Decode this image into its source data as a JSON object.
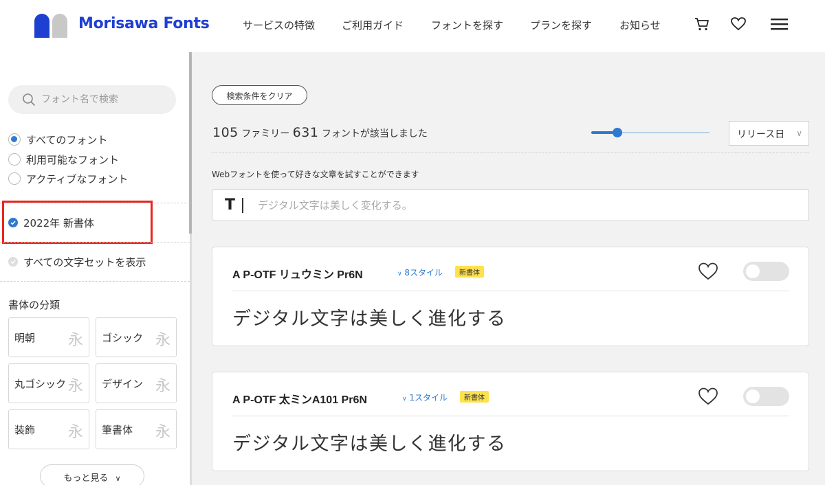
{
  "header": {
    "brand": "Morisawa Fonts",
    "nav": [
      "サービスの特徴",
      "ご利用ガイド",
      "フォントを探す",
      "プランを探す",
      "お知らせ"
    ],
    "icons": [
      "cart-icon",
      "heart-icon",
      "hamburger-menu-icon"
    ],
    "brand_color": "#1f3fd1"
  },
  "sidebar": {
    "search_placeholder": "フォント名で検索",
    "font_scope": [
      {
        "label": "すべてのフォント",
        "selected": true
      },
      {
        "label": "利用可能なフォント",
        "selected": false
      },
      {
        "label": "アクティブなフォント",
        "selected": false
      }
    ],
    "new_fonts_filter": {
      "label": "2022年 新書体",
      "checked": true
    },
    "charset_filter": {
      "label": "すべての文字セットを表示",
      "checked": false
    },
    "classification_title": "書体の分類",
    "categories": [
      {
        "label": "明朝",
        "glyph": "永"
      },
      {
        "label": "ゴシック",
        "glyph": "永"
      },
      {
        "label": "丸ゴシック",
        "glyph": "永"
      },
      {
        "label": "デザイン",
        "glyph": "永"
      },
      {
        "label": "装飾",
        "glyph": "永"
      },
      {
        "label": "筆書体",
        "glyph": "永"
      }
    ],
    "more_label": "もっと見る"
  },
  "main": {
    "clear_label": "検索条件をクリア",
    "result": {
      "families": "105",
      "families_unit": "ファミリー",
      "fonts": "631",
      "fonts_suffix": "フォントが該当しました"
    },
    "size_slider_fraction": 0.22,
    "sort_label": "リリース日",
    "hint": "Webフォントを使って好きな文章を試すことができます",
    "try_icon_letter": "T",
    "try_placeholder": "デジタル文字は美しく変化する。",
    "accent_color": "#2e7ad1",
    "badge_color": "#ffe14d"
  },
  "cards": [
    {
      "name": "A P-OTF リュウミン Pr6N",
      "styles": "8スタイル",
      "badge": "新書体",
      "sample": "デジタル文字は美しく進化する",
      "active": false
    },
    {
      "name": "A P-OTF 太ミンA101 Pr6N",
      "styles": "1スタイル",
      "badge": "新書体",
      "sample": "デジタル文字は美しく進化する",
      "active": false
    }
  ]
}
